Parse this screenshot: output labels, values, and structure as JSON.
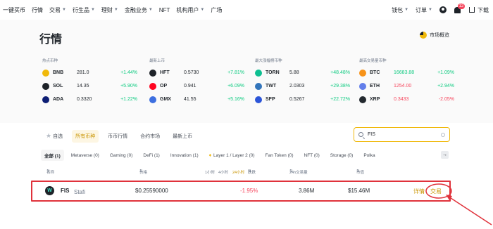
{
  "nav": {
    "items": [
      {
        "label": "一键买币",
        "caret": false
      },
      {
        "label": "行情",
        "caret": false
      },
      {
        "label": "交易",
        "caret": true
      },
      {
        "label": "衍生品",
        "caret": true
      },
      {
        "label": "理财",
        "caret": true
      },
      {
        "label": "金融业务",
        "caret": true
      },
      {
        "label": "NFT",
        "caret": false
      },
      {
        "label": "机构用户",
        "caret": true
      },
      {
        "label": "广场",
        "caret": false
      }
    ],
    "wallet": "钱包",
    "orders": "订单",
    "notifications_count": "12",
    "download": "下载"
  },
  "page": {
    "title": "行情",
    "overview": "市场概览"
  },
  "sections": [
    {
      "title": "热点币种",
      "coins": [
        {
          "symbol": "BNB",
          "price": "281.0",
          "change": "+1.44%",
          "dir": "up",
          "icon_color": "#f0b90b",
          "icon": "bnb-icon"
        },
        {
          "symbol": "SOL",
          "price": "14.35",
          "change": "+5.90%",
          "dir": "up",
          "icon_color": "#1e2329",
          "icon": "sol-icon"
        },
        {
          "symbol": "ADA",
          "price": "0.3320",
          "change": "+1.22%",
          "dir": "up",
          "icon_color": "#0d1e74",
          "icon": "ada-icon"
        }
      ]
    },
    {
      "title": "最新上币",
      "coins": [
        {
          "symbol": "HFT",
          "price": "0.5730",
          "change": "+7.81%",
          "dir": "up",
          "icon_color": "#1e2329",
          "icon": "hft-icon"
        },
        {
          "symbol": "OP",
          "price": "0.941",
          "change": "+6.09%",
          "dir": "up",
          "icon_color": "#ff0420",
          "icon": "op-icon"
        },
        {
          "symbol": "GMX",
          "price": "41.55",
          "change": "+5.16%",
          "dir": "up",
          "icon_color": "#3d6fe0",
          "icon": "gmx-icon"
        }
      ]
    },
    {
      "title": "最大涨幅榜币种",
      "coins": [
        {
          "symbol": "TORN",
          "price": "5.88",
          "change": "+48.48%",
          "dir": "up",
          "icon_color": "#0dbf91",
          "icon": "torn-icon"
        },
        {
          "symbol": "TWT",
          "price": "2.0303",
          "change": "+29.38%",
          "dir": "up",
          "icon_color": "#3375bb",
          "icon": "twt-icon"
        },
        {
          "symbol": "SFP",
          "price": "0.5267",
          "change": "+22.72%",
          "dir": "up",
          "icon_color": "#2c55d8",
          "icon": "sfp-icon"
        }
      ]
    },
    {
      "title": "最高交易量币种",
      "coins": [
        {
          "symbol": "BTC",
          "price": "16683.88",
          "change": "+1.09%",
          "dir": "up",
          "price_dir": "up",
          "icon_color": "#f7931a",
          "icon": "btc-icon"
        },
        {
          "symbol": "ETH",
          "price": "1254.00",
          "change": "+2.94%",
          "dir": "up",
          "price_dir": "down",
          "icon_color": "#627eea",
          "icon": "eth-icon"
        },
        {
          "symbol": "XRP",
          "price": "0.3433",
          "change": "-2.05%",
          "dir": "down",
          "price_dir": "down",
          "icon_color": "#23292f",
          "icon": "xrp-icon"
        }
      ]
    }
  ],
  "tabs1": [
    {
      "label": "自选",
      "active": false,
      "star": true
    },
    {
      "label": "所有币种",
      "active": true
    },
    {
      "label": "币币行情",
      "active": false
    },
    {
      "label": "合约市场",
      "active": false
    },
    {
      "label": "最新上币",
      "active": false
    }
  ],
  "search": {
    "value": "FIS"
  },
  "tabs2": [
    {
      "label": "全部 (1)",
      "active": true
    },
    {
      "label": "Metaverse (0)",
      "active": false
    },
    {
      "label": "Gaming (0)",
      "active": false
    },
    {
      "label": "DeFi (1)",
      "active": false
    },
    {
      "label": "Innovation (1)",
      "active": false
    },
    {
      "label": "Layer 1 / Layer 2 (0)",
      "active": false,
      "fire": true
    },
    {
      "label": "Fan Token (0)",
      "active": false
    },
    {
      "label": "NFT (0)",
      "active": false
    },
    {
      "label": "Storage (0)",
      "active": false
    },
    {
      "label": "Polka",
      "active": false
    }
  ],
  "table_header": {
    "name": "名称",
    "price": "价格",
    "h1": "1小时",
    "h4": "4小时",
    "h24": "24小时",
    "change": "跌跌",
    "volume": "24h交易量",
    "mcap": "市值"
  },
  "row": {
    "symbol": "FIS",
    "name": "Stafi",
    "price": "$0.25590000",
    "change": "-1.95%",
    "volume": "3.86M",
    "mcap": "$15.46M",
    "detail": "详情",
    "trade": "交易"
  }
}
